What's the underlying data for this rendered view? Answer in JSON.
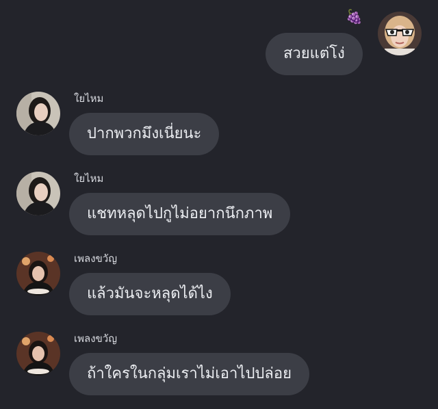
{
  "messages": [
    {
      "direction": "outgoing",
      "sender": "",
      "text": "สวยแต่โง่",
      "reaction": "🍇",
      "avatar": "user-avatar-sunglasses"
    },
    {
      "direction": "incoming",
      "sender": "ใยไหม",
      "text": "ปากพวกมึงเนี่ยนะ",
      "avatar": "contact-avatar-yaimai"
    },
    {
      "direction": "incoming",
      "sender": "ใยไหม",
      "text": "แชทหลุดไปกูไม่อยากนึกภาพ",
      "avatar": "contact-avatar-yaimai"
    },
    {
      "direction": "incoming",
      "sender": "เพลงขวัญ",
      "text": "แล้วมันจะหลุดได้ไง",
      "avatar": "contact-avatar-plengkwan"
    },
    {
      "direction": "incoming",
      "sender": "เพลงขวัญ",
      "text": "ถ้าใครในกลุ่มเราไม่เอาไปปล่อย",
      "avatar": "contact-avatar-plengkwan"
    }
  ],
  "colors": {
    "background": "#23242b",
    "bubble": "#3c3e46",
    "text": "#eceef2"
  }
}
